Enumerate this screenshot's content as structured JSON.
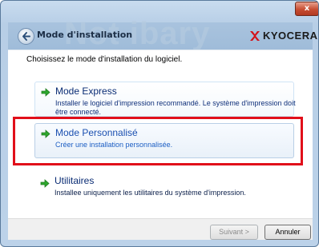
{
  "window": {
    "close_symbol": "x",
    "title": "Mode d'installation",
    "brand": "KYOCERA",
    "header_watermark": "Not ibary"
  },
  "content": {
    "instruction": "Choisissez le mode d'installation du logiciel.",
    "options": [
      {
        "title": "Mode Express",
        "description": "Installer le logiciel d'impression recommandé. Le système d'impression doit être connecté.",
        "icon": "green-arrow-icon"
      },
      {
        "title": "Mode Personnalisé",
        "description": "Créer une installation personnalisée.",
        "icon": "green-arrow-icon",
        "selected": true
      },
      {
        "title": "Utilitaires",
        "description": "Installee uniquement les utilitaires du système d'impression.",
        "icon": "green-arrow-icon"
      }
    ]
  },
  "footer": {
    "next_label": "Suivant >",
    "cancel_label": "Annuler"
  },
  "colors": {
    "highlight_border": "#e10f1a",
    "arrow_green": "#2ea82e",
    "logo_red": "#d4121a"
  }
}
